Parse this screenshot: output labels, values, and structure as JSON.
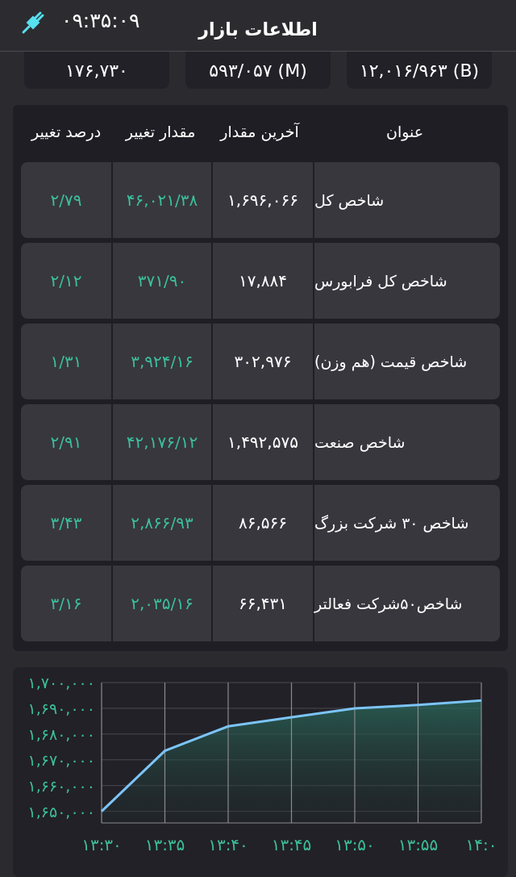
{
  "header": {
    "title": "اطلاعات بازار",
    "time": "۰۹:۳۵:۰۹"
  },
  "summary_cards": [
    {
      "value": "۱۲,۰۱۶/۹۶۳ (B)"
    },
    {
      "value": "۵۹۳/۰۵۷ (M)"
    },
    {
      "value": "۱۷۶,۷۳۰"
    }
  ],
  "table": {
    "columns": [
      "عنوان",
      "آخرین مقدار",
      "مقدار تغییر",
      "درصد تغییر"
    ],
    "rows": [
      {
        "title": "شاخص کل",
        "last": "۱,۶۹۶,۰۶۶",
        "change": "۴۶,۰۲۱/۳۸",
        "percent": "۲/۷۹"
      },
      {
        "title": "شاخص کل فرابورس",
        "last": "۱۷,۸۸۴",
        "change": "۳۷۱/۹۰",
        "percent": "۲/۱۲"
      },
      {
        "title": "شاخص قیمت (هم وزن)",
        "last": "۳۰۲,۹۷۶",
        "change": "۳,۹۲۴/۱۶",
        "percent": "۱/۳۱"
      },
      {
        "title": "شاخص صنعت",
        "last": "۱,۴۹۲,۵۷۵",
        "change": "۴۲,۱۷۶/۱۲",
        "percent": "۲/۹۱"
      },
      {
        "title": "شاخص ۳۰ شرکت بزرگ",
        "last": "۸۶,۵۶۶",
        "change": "۲,۸۶۶/۹۳",
        "percent": "۳/۴۳"
      },
      {
        "title": "شاخص۵۰شرکت فعالتر",
        "last": "۶۶,۴۳۱",
        "change": "۲,۰۳۵/۱۶",
        "percent": "۳/۱۶"
      }
    ]
  },
  "chart": {
    "chart_data": {
      "type": "area",
      "categories": [
        "۱۳:۳۰",
        "۱۳:۳۵",
        "۱۳:۴۰",
        "۱۳:۴۵",
        "۱۳:۵۰",
        "۱۳:۵۵",
        "۱۴:۰"
      ],
      "grid": true,
      "series": [
        {
          "color": "#7cc4f8",
          "values": [
            1650000,
            1673500,
            1683000,
            1686500,
            1690000,
            1691300,
            1693000
          ]
        }
      ],
      "ylim": [
        1645500,
        1700000
      ],
      "yticks": [
        {
          "value": 1650000,
          "label": "۱,۶۵۰,۰۰۰"
        },
        {
          "value": 1660000,
          "label": "۱,۶۶۰,۰۰۰"
        },
        {
          "value": 1670000,
          "label": "۱,۶۷۰,۰۰۰"
        },
        {
          "value": 1680000,
          "label": "۱,۶۸۰,۰۰۰"
        },
        {
          "value": 1690000,
          "label": "۱,۶۹۰,۰۰۰"
        },
        {
          "value": 1700000,
          "label": "۱,۷۰۰,۰۰۰"
        }
      ]
    }
  }
}
